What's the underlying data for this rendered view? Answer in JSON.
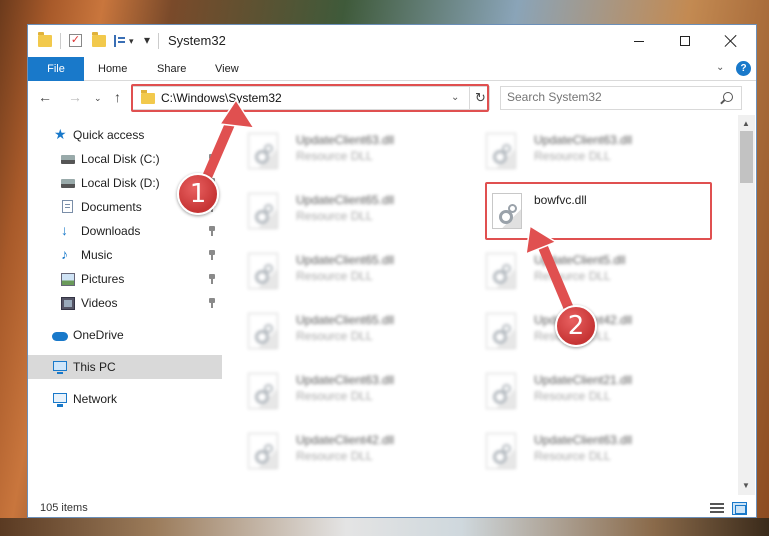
{
  "window": {
    "title": "System32"
  },
  "ribbon": {
    "tabs": [
      "File",
      "Home",
      "Share",
      "View"
    ],
    "help_label": "?"
  },
  "address": {
    "path": "C:\\Windows\\System32"
  },
  "search": {
    "placeholder": "Search System32"
  },
  "sidebar": {
    "items": [
      {
        "label": "Quick access"
      },
      {
        "label": "Local Disk (C:)"
      },
      {
        "label": "Local Disk (D:)"
      },
      {
        "label": "Documents"
      },
      {
        "label": "Downloads"
      },
      {
        "label": "Music"
      },
      {
        "label": "Pictures"
      },
      {
        "label": "Videos"
      },
      {
        "label": "OneDrive"
      },
      {
        "label": "This PC"
      },
      {
        "label": "Network"
      }
    ]
  },
  "files": [
    {
      "name": "UpdateClient63.dll",
      "type": "Resource DLL"
    },
    {
      "name": "UpdateClient63.dll",
      "type": "Resource DLL"
    },
    {
      "name": "UpdateClient65.dll",
      "type": "Resource DLL"
    },
    {
      "name": "bowfvc.dll",
      "type": ""
    },
    {
      "name": "UpdateClient65.dll",
      "type": "Resource DLL"
    },
    {
      "name": "UpdateClient5.dll",
      "type": "Resource DLL"
    },
    {
      "name": "UpdateClient65.dll",
      "type": "Resource DLL"
    },
    {
      "name": "UpdateClient42.dll",
      "type": "Resource DLL"
    },
    {
      "name": "UpdateClient63.dll",
      "type": "Resource DLL"
    },
    {
      "name": "UpdateClient21.dll",
      "type": "Resource DLL"
    },
    {
      "name": "UpdateClient42.dll",
      "type": "Resource DLL"
    },
    {
      "name": "UpdateClient63.dll",
      "type": "Resource DLL"
    }
  ],
  "status": {
    "item_count": "105 items"
  },
  "annotations": {
    "step1": "1",
    "step2": "2"
  },
  "colors": {
    "accent": "#1979ca",
    "highlight": "#e05050"
  }
}
